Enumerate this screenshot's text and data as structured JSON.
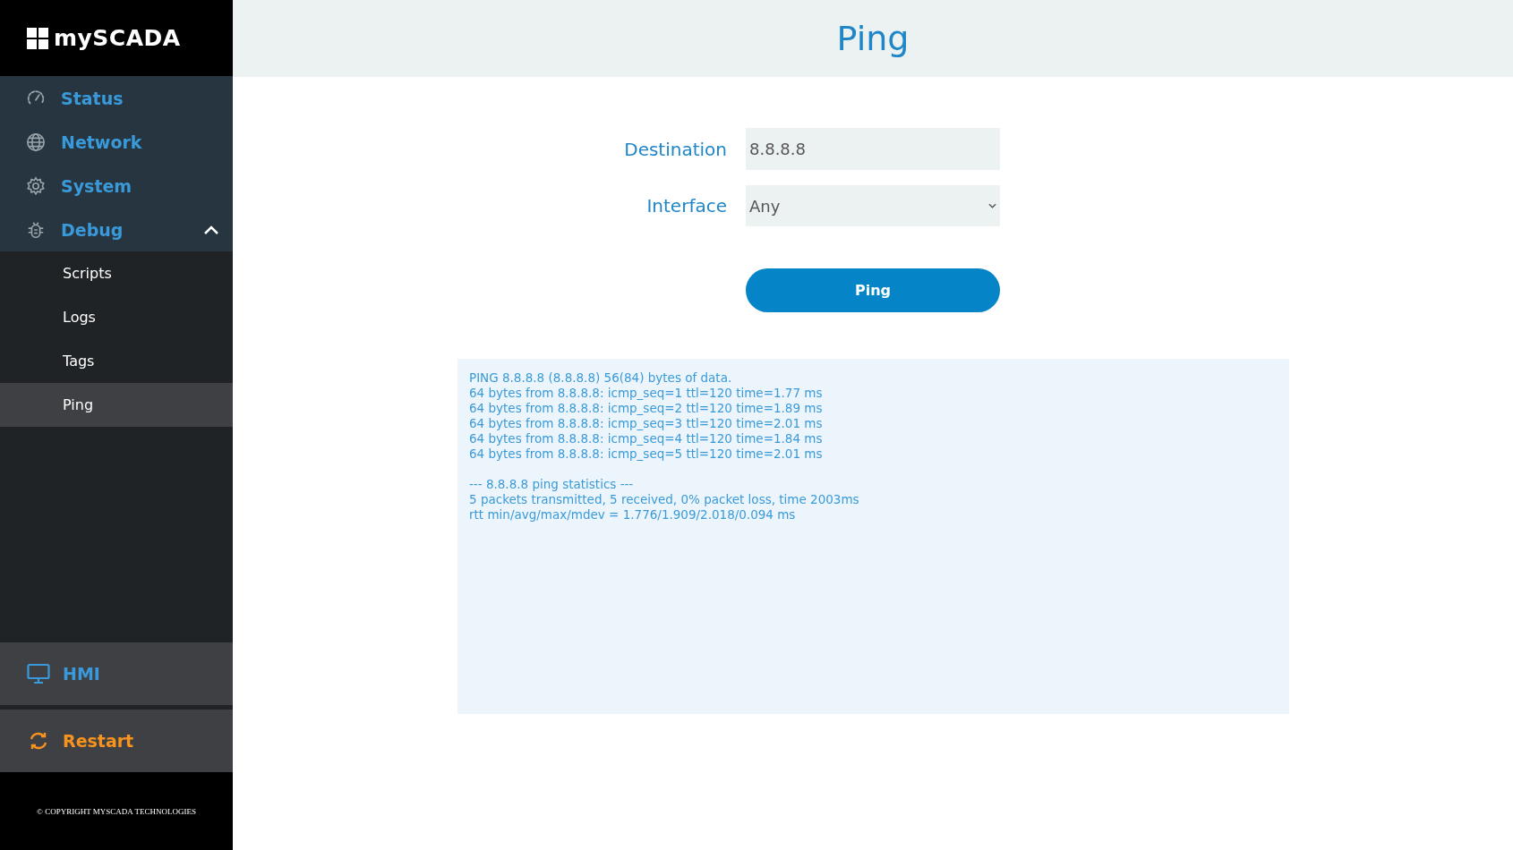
{
  "sidebar": {
    "logo": "mySCADA",
    "items": [
      {
        "kind": "gauge",
        "label": "Status"
      },
      {
        "kind": "globe",
        "label": "Network"
      },
      {
        "kind": "gear",
        "label": "System"
      },
      {
        "kind": "bug",
        "label": "Debug",
        "expanded": true,
        "children": [
          {
            "label": "Scripts",
            "selected": false
          },
          {
            "label": "Logs",
            "selected": false
          },
          {
            "label": "Tags",
            "selected": false
          },
          {
            "label": "Ping",
            "selected": true
          }
        ]
      }
    ],
    "bottom_items": [
      {
        "kind": "hmi",
        "label": "HMI"
      },
      {
        "kind": "restart",
        "label": "Restart"
      }
    ],
    "copyright": "© COPYRIGHT MYSCADA TECHNOLOGIES"
  },
  "page": {
    "title": "Ping",
    "destination": {
      "label": "Destination",
      "value": "8.8.8.8"
    },
    "interface": {
      "label": "Interface",
      "value": "Any"
    },
    "button": "Ping",
    "output": {
      "lines": [
        "PING 8.8.8.8 (8.8.8.8) 56(84) bytes of data.",
        "64 bytes from 8.8.8.8: icmp_seq=1 ttl=120 time=1.77 ms",
        "64 bytes from 8.8.8.8: icmp_seq=2 ttl=120 time=1.89 ms",
        "64 bytes from 8.8.8.8: icmp_seq=3 ttl=120 time=2.01 ms",
        "64 bytes from 8.8.8.8: icmp_seq=4 ttl=120 time=1.84 ms",
        "64 bytes from 8.8.8.8: icmp_seq=5 ttl=120 time=2.01 ms"
      ],
      "statistics": [
        "--- 8.8.8.8 ping statistics ---",
        "5 packets transmitted, 5 received, 0% packet loss, time 2003ms",
        "rtt min/avg/max/mdev = 1.776/1.909/2.018/0.094 ms"
      ]
    }
  }
}
